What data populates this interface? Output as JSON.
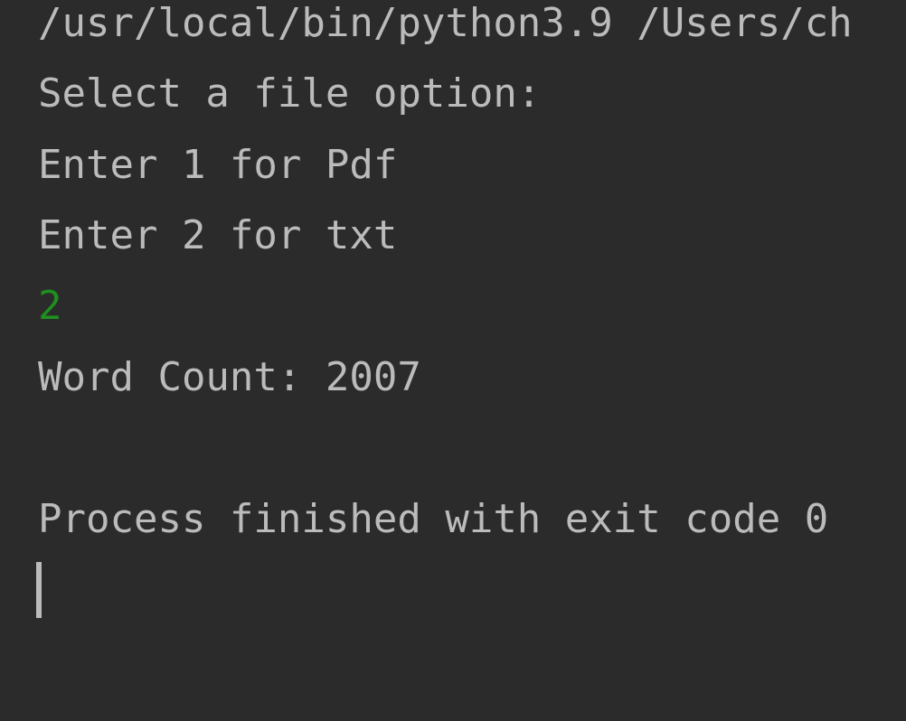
{
  "console": {
    "lines": [
      "/usr/local/bin/python3.9 /Users/ch",
      "Select a file option:",
      "Enter 1 for Pdf",
      "Enter 2 for txt",
      "2",
      "Word Count: 2007",
      "Process finished with exit code 0"
    ]
  },
  "colors": {
    "background": "#2b2b2b",
    "text": "#bbbbbb",
    "user_input": "#1f8f1f"
  }
}
